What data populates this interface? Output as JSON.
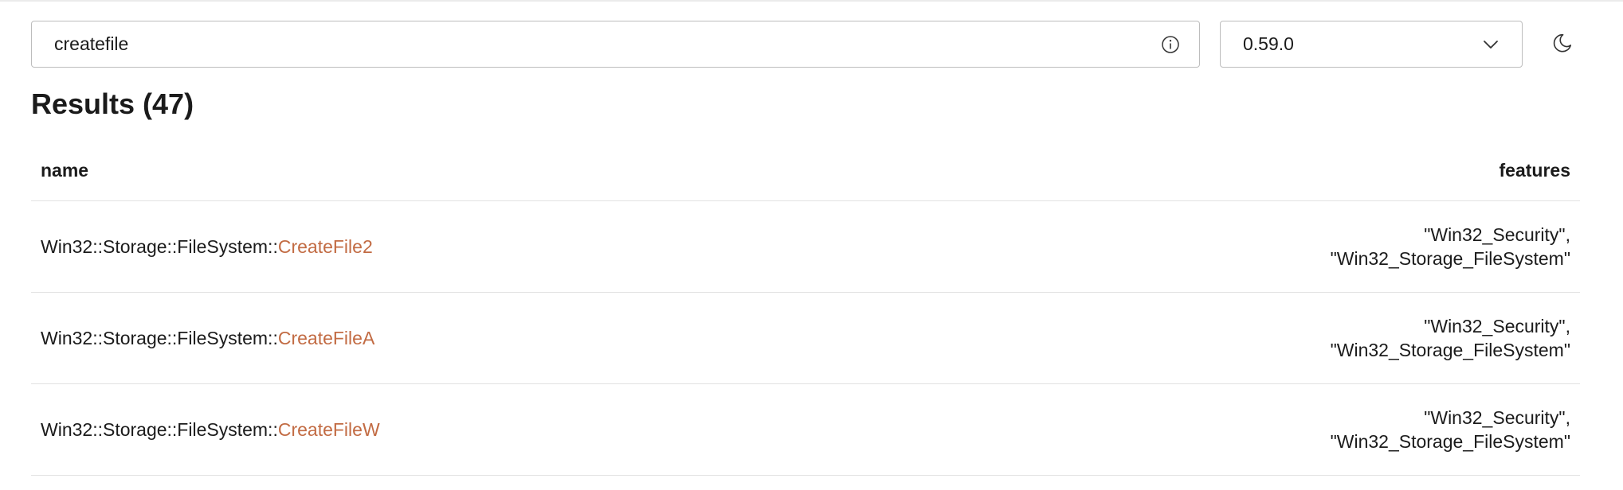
{
  "search": {
    "value": "createfile",
    "placeholder": ""
  },
  "version_select": {
    "selected": "0.59.0"
  },
  "icons": {
    "info": "info-icon",
    "chevron": "chevron-down-icon",
    "theme": "moon-icon"
  },
  "results": {
    "heading": "Results (47)",
    "columns": {
      "name": "name",
      "features": "features"
    },
    "rows": [
      {
        "namespace": "Win32::Storage::FileSystem::",
        "item": "CreateFile2",
        "features": [
          "\"Win32_Security\",",
          "\"Win32_Storage_FileSystem\""
        ]
      },
      {
        "namespace": "Win32::Storage::FileSystem::",
        "item": "CreateFileA",
        "features": [
          "\"Win32_Security\",",
          "\"Win32_Storage_FileSystem\""
        ]
      },
      {
        "namespace": "Win32::Storage::FileSystem::",
        "item": "CreateFileW",
        "features": [
          "\"Win32_Security\",",
          "\"Win32_Storage_FileSystem\""
        ]
      }
    ]
  },
  "colors": {
    "link": "#c26b43",
    "text": "#1b1b1b",
    "border": "#bdbdbd",
    "divider": "#e2e2e2"
  }
}
